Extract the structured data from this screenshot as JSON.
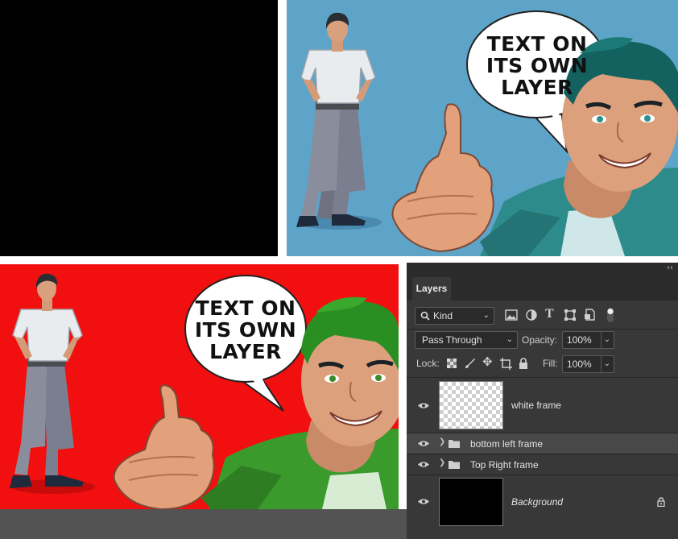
{
  "canvas": {
    "speech_bubble_top_right": [
      "TEXT ON",
      "ITS OWN",
      "LAYER"
    ],
    "speech_bubble_bottom_left": [
      "TEXT ON",
      "ITS OWN",
      "LAYER"
    ],
    "colors": {
      "top_left_fill": "#000000",
      "top_right_background": "#5ea4c8",
      "bottom_left_background": "#f10f0f",
      "top_right_hair": "#14625f",
      "top_right_shirt": "#2e8b8c",
      "bottom_left_hair": "#2a8f22",
      "bottom_left_shirt": "#3a9a2c"
    }
  },
  "layers_panel": {
    "collapse_icon": "double-chevron-left-icon",
    "tab_label": "Layers",
    "filter": {
      "icon": "search-icon",
      "value": "Kind"
    },
    "filter_icons": [
      "image-filter-icon",
      "adjustment-filter-icon",
      "type-filter-icon",
      "shape-filter-icon",
      "smart-object-filter-icon",
      "filter-toggle-icon"
    ],
    "blend_mode": "Pass Through",
    "opacity_label": "Opacity:",
    "opacity_value": "100%",
    "lock_label": "Lock:",
    "lock_icons": [
      "lock-transparency-icon",
      "lock-pixels-icon",
      "lock-position-icon",
      "lock-artboard-icon",
      "lock-all-icon"
    ],
    "fill_label": "Fill:",
    "fill_value": "100%",
    "layers": [
      {
        "name": "white frame",
        "type": "pixel",
        "visible": true
      },
      {
        "name": "bottom left frame",
        "type": "group",
        "visible": true,
        "selected": true
      },
      {
        "name": "Top Right frame",
        "type": "group",
        "visible": true
      },
      {
        "name": "Background",
        "type": "background",
        "visible": true,
        "locked": true
      }
    ]
  }
}
